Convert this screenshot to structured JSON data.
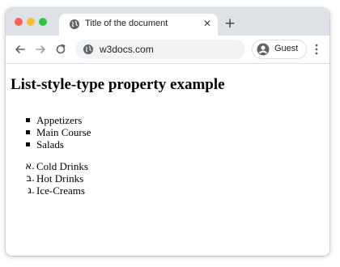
{
  "browser": {
    "tab_title": "Title of the document",
    "tab_close_glyph": "✕",
    "new_tab_glyph": "+",
    "url": "w3docs.com",
    "profile_label": "Guest",
    "colors": {
      "tabstrip": "#dee1e6",
      "close_dot": "#ff5f57",
      "minimize_dot": "#febc2e",
      "zoom_dot": "#28c840",
      "omnibox": "#f1f3f4"
    },
    "icons": [
      "globe-icon",
      "back-arrow-icon",
      "forward-arrow-icon",
      "reload-icon",
      "profile-icon",
      "kebab-menu-icon"
    ]
  },
  "page": {
    "heading": "List-style-type property example",
    "square_list": [
      {
        "label": "Appetizers"
      },
      {
        "label": "Main Course"
      },
      {
        "label": "Salads"
      }
    ],
    "hebrew_list": [
      {
        "marker": "א.",
        "label": "Cold Drinks"
      },
      {
        "marker": "ב.",
        "label": "Hot Drinks"
      },
      {
        "marker": "ג.",
        "label": "Ice-Creams"
      }
    ]
  }
}
